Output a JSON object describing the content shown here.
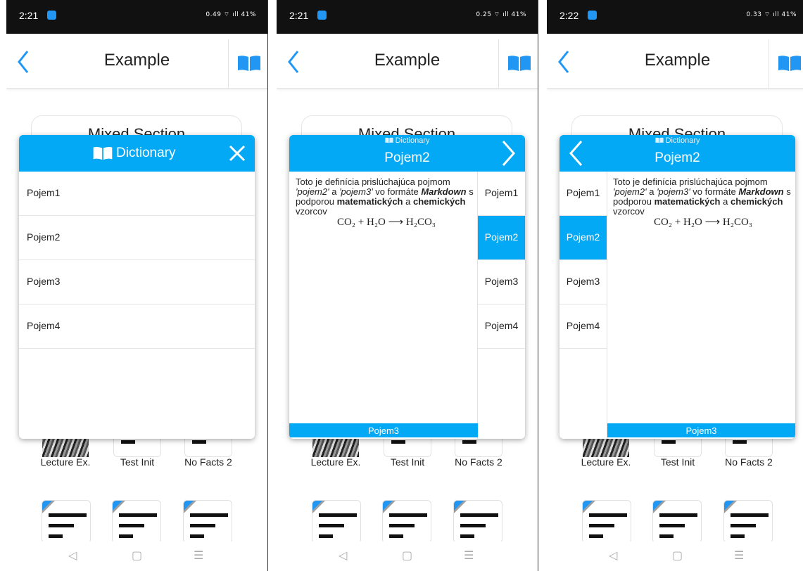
{
  "status": [
    {
      "time": "2:21",
      "right": "0.49 ⌔ ıll 41%"
    },
    {
      "time": "2:21",
      "right": "0.25 ⌔ ıll 41%"
    },
    {
      "time": "2:22",
      "right": "0.33 ⌔ ıll 41%"
    }
  ],
  "app": {
    "title": "Example",
    "section_title": "Mixed Section"
  },
  "tiles": [
    {
      "label": "Lecture Ex."
    },
    {
      "label": "Test Init"
    },
    {
      "label": "No Facts 2"
    }
  ],
  "dictionary": {
    "title": "Dictionary",
    "terms": [
      "Pojem1",
      "Pojem2",
      "Pojem3",
      "Pojem4"
    ],
    "selected_term": "Pojem2",
    "next_term": "Pojem3",
    "definition": {
      "p1": "Toto je definícia prislúchajúca pojmom ",
      "i1": "'pojem2'",
      "p2": " a ",
      "i2": "'pojem3'",
      "p3": " vo formáte ",
      "bi": "Markdown",
      "p4": " s podporou ",
      "b1": "matematických",
      "p5": " a ",
      "b2": "chemických",
      "p6": " vzorcov",
      "formula": "CO₂ + H₂O ⟶ H₂CO₃"
    }
  },
  "colors": {
    "accent": "#03a9f4",
    "icon_blue": "#2196f3"
  },
  "icons": [
    "back-chevron-icon",
    "book-icon",
    "close-icon",
    "forward-chevron-icon",
    "nav-back-icon",
    "nav-home-icon",
    "nav-menu-icon"
  ]
}
